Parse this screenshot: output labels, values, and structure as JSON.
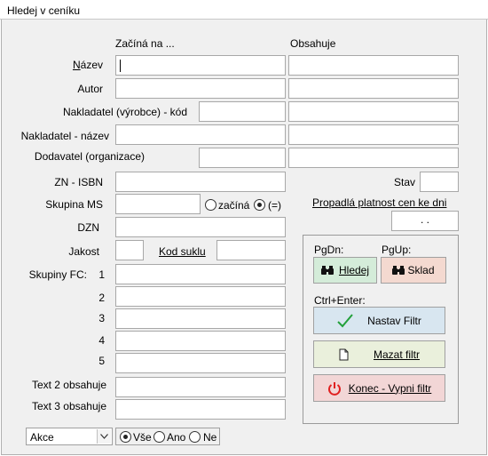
{
  "window": {
    "title": "Hledej v ceníku"
  },
  "headers": {
    "starts_with": "Začíná na ...",
    "contains": "Obsahuje"
  },
  "fields": {
    "nazev": "Název",
    "autor": "Autor",
    "nakl_kod": "Nakladatel (výrobce) - kód",
    "nakl_nazev": "Nakladatel - název",
    "dodavatel": "Dodavatel (organizace)",
    "zn_isbn": "ZN - ISBN",
    "stav": "Stav",
    "skupina_ms": "Skupina MS",
    "propadla": "Propadlá platnost cen ke dni",
    "propadla_value": ". .",
    "dzn": "DZN",
    "jakost": "Jakost",
    "kod_suklu": "Kod suklu",
    "skupiny_fc": "Skupiny FC:",
    "fc_numbers": [
      "1",
      "2",
      "3",
      "4",
      "5"
    ],
    "text2": "Text 2 obsahuje",
    "text3": "Text 3 obsahuje"
  },
  "skupina_mode": {
    "starts": "začíná",
    "equals": "(=)",
    "selected": "equals"
  },
  "panel": {
    "pgdn": "PgDn:",
    "pgup": "PgUp:",
    "hledej": "Hledej",
    "sklad": "Sklad",
    "ctrl_enter": "Ctrl+Enter:",
    "nastav_filtr": "Nastav Filtr",
    "mazat_filtr": "Mazat filtr",
    "konec": "Konec - Vypni filtr"
  },
  "bottom": {
    "action_combo": "Akce",
    "filter_options": [
      "Vše",
      "Ano",
      "Ne"
    ],
    "filter_selected": "Vše"
  },
  "colors": {
    "hledej_bg": "#d4ecd9",
    "sklad_bg": "#f4d9d0",
    "nastav_bg": "#d8e6f0",
    "mazat_bg": "#eaf0dc",
    "konec_bg": "#f2d6d6",
    "check_green": "#22a03a",
    "power_red": "#e02020"
  },
  "icons": {
    "hledej": "binoculars-icon",
    "sklad": "binoculars-icon",
    "nastav": "checkmark-icon",
    "mazat": "document-icon",
    "konec": "power-icon"
  }
}
